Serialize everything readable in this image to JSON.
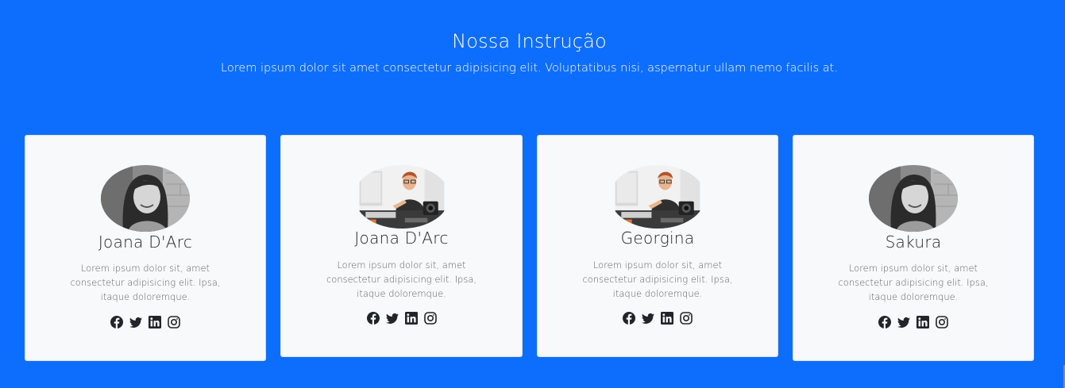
{
  "section": {
    "title": "Nossa Instrução",
    "subtitle": "Lorem ipsum dolor sit amet consectetur adipisicing elit. Voluptatibus nisi, aspernatur ullam nemo facilis at."
  },
  "colors": {
    "background": "#0d6efd",
    "card": "#f8f9fa",
    "text": "#212529"
  },
  "cards": [
    {
      "name": "Joana D'Arc",
      "description": "Lorem ipsum dolor sit, amet consectetur adipisicing elit. Ipsa, itaque doloremque.",
      "photo": "grayscale-portrait-woman",
      "social": [
        "facebook-icon",
        "twitter-icon",
        "linkedin-icon",
        "instagram-icon"
      ]
    },
    {
      "name": "Joana D'Arc",
      "description": "Lorem ipsum dolor sit, amet consectetur adipisicing elit. Ipsa, itaque doloremque.",
      "photo": "woman-at-desk-with-camera",
      "social": [
        "facebook-icon",
        "twitter-icon",
        "linkedin-icon",
        "instagram-icon"
      ]
    },
    {
      "name": "Georgina",
      "description": "Lorem ipsum dolor sit, amet consectetur adipisicing elit. Ipsa, itaque doloremque.",
      "photo": "woman-at-desk-with-camera",
      "social": [
        "facebook-icon",
        "twitter-icon",
        "linkedin-icon",
        "instagram-icon"
      ]
    },
    {
      "name": "Sakura",
      "description": "Lorem ipsum dolor sit, amet consectetur adipisicing elit. Ipsa, itaque doloremque.",
      "photo": "grayscale-portrait-woman",
      "social": [
        "facebook-icon",
        "twitter-icon",
        "linkedin-icon",
        "instagram-icon"
      ]
    }
  ]
}
